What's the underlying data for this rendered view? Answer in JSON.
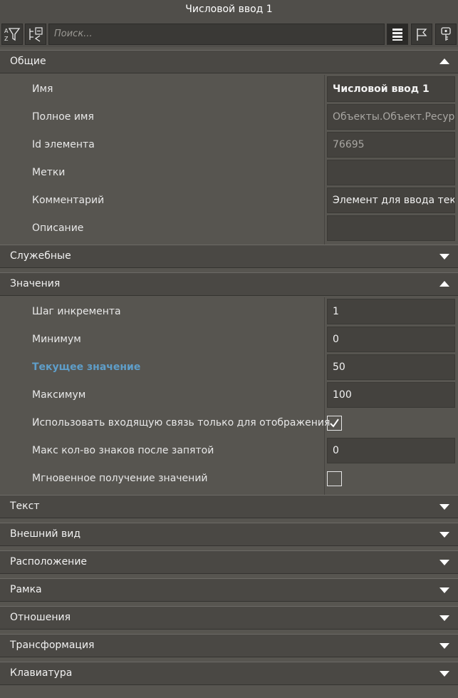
{
  "window": {
    "title": "Числовой ввод 1"
  },
  "toolbar": {
    "search_placeholder": "Поиск...",
    "buttons": [
      "sort-filter-icon",
      "collapse-tree-icon",
      "list-view-icon",
      "flag-icon",
      "key-icon"
    ]
  },
  "sections": {
    "general": {
      "label": "Общие",
      "expanded": true,
      "rows": [
        {
          "label": "Имя",
          "value": "Числовой ввод 1"
        },
        {
          "label": "Полное имя",
          "value": "Объекты.Объект.Ресурсы"
        },
        {
          "label": "Id элемента",
          "value": "76695"
        },
        {
          "label": "Метки",
          "value": ""
        },
        {
          "label": "Комментарий",
          "value": "Элемент для ввода текста"
        },
        {
          "label": "Описание",
          "value": ""
        }
      ]
    },
    "service": {
      "label": "Служебные",
      "expanded": false
    },
    "values": {
      "label": "Значения",
      "expanded": true,
      "rows": [
        {
          "label": "Шаг инкремента",
          "value": "1"
        },
        {
          "label": "Минимум",
          "value": "0"
        },
        {
          "label": "Текущее значение",
          "value": "50"
        },
        {
          "label": "Максимум",
          "value": "100"
        },
        {
          "label": "Использовать входящую связь только для отображения",
          "checked": true
        },
        {
          "label": "Макс кол-во знаков после запятой",
          "value": "0"
        },
        {
          "label": "Мгновенное получение значений",
          "checked": false
        }
      ]
    },
    "text": {
      "label": "Текст",
      "expanded": false
    },
    "appearance": {
      "label": "Внешний вид",
      "expanded": false
    },
    "position": {
      "label": "Расположение",
      "expanded": false
    },
    "frame": {
      "label": "Рамка",
      "expanded": false
    },
    "relations": {
      "label": "Отношения",
      "expanded": false
    },
    "transform": {
      "label": "Трансформация",
      "expanded": false
    },
    "keyboard": {
      "label": "Клавиатура",
      "expanded": false
    }
  },
  "colors": {
    "background": "#575550",
    "section": "#4a4844",
    "field": "#44423e",
    "highlight": "#5f9ec9"
  }
}
